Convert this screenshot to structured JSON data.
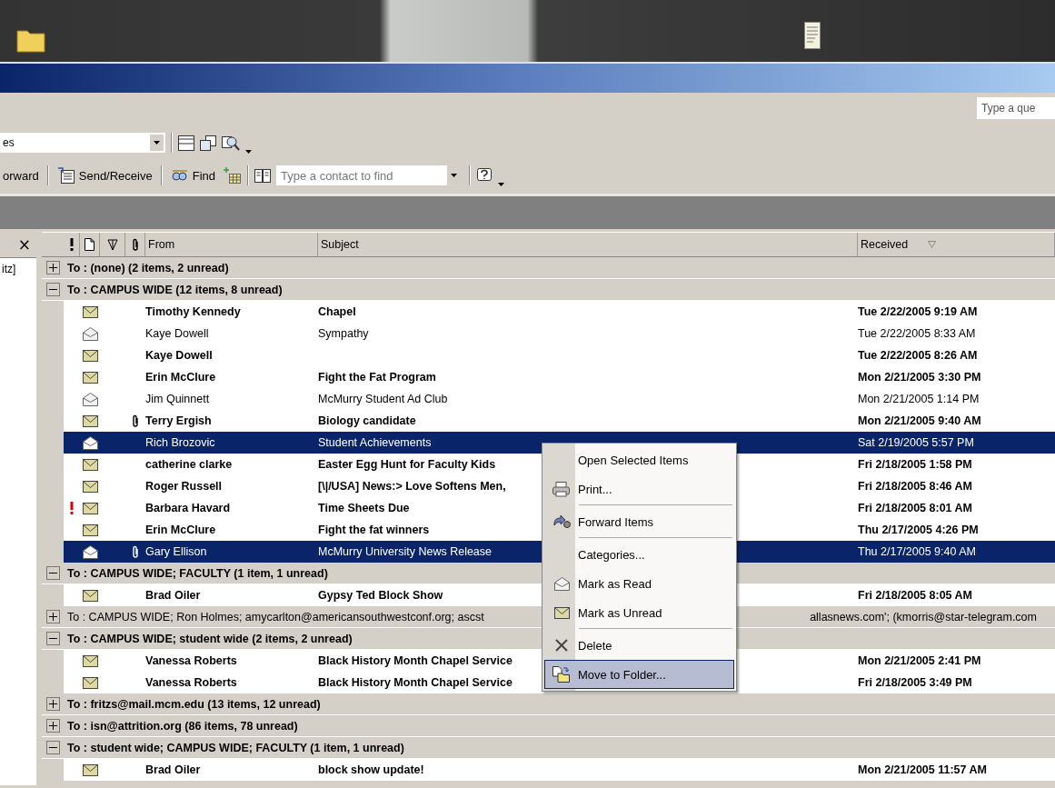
{
  "help_field": {
    "placeholder": "Type a que"
  },
  "toolbar_view": {
    "combo_value": "es"
  },
  "toolbar_standard": {
    "buttons": [
      {
        "kind": "forward",
        "label": "orward"
      },
      {
        "kind": "send-receive",
        "label": "Send/Receive"
      },
      {
        "kind": "find",
        "label": "Find"
      }
    ],
    "contact_search": {
      "placeholder": "Type a contact to find"
    }
  },
  "folder_pane": {
    "close_label": "×",
    "text": "itz]"
  },
  "message_list": {
    "columns": [
      {
        "label": "From",
        "sorted": false
      },
      {
        "label": "Subject",
        "sorted": false
      },
      {
        "label": "Received",
        "sorted": true
      }
    ],
    "groups": [
      {
        "text": "To : (none) (2 items, 2 unread)",
        "expanded": false,
        "has_unread": true
      },
      {
        "text": "To : CAMPUS WIDE (12 items, 8 unread)",
        "expanded": true,
        "has_unread": true,
        "messages": [
          {
            "from": "Timothy Kennedy",
            "subject": "Chapel",
            "received": "Tue 2/22/2005 9:19 AM",
            "read": false,
            "selected": false,
            "high_importance": false,
            "attachment": false
          },
          {
            "from": "Kaye Dowell",
            "subject": "Sympathy",
            "received": "Tue 2/22/2005 8:33 AM",
            "read": true,
            "selected": false,
            "high_importance": false,
            "attachment": false
          },
          {
            "from": "Kaye Dowell",
            "received": "Tue 2/22/2005 8:26 AM",
            "read": false,
            "selected": false,
            "high_importance": false,
            "attachment": false
          },
          {
            "from": "Erin McClure",
            "subject": "Fight the Fat Program",
            "received": "Mon 2/21/2005 3:30 PM",
            "read": false,
            "selected": false,
            "high_importance": false,
            "attachment": false
          },
          {
            "from": "Jim Quinnett",
            "subject": "McMurry Student Ad Club",
            "received": "Mon 2/21/2005 1:14 PM",
            "read": true,
            "selected": false,
            "high_importance": false,
            "attachment": false
          },
          {
            "from": "Terry Ergish",
            "subject": "Biology candidate",
            "received": "Mon 2/21/2005 9:40 AM",
            "read": false,
            "selected": false,
            "high_importance": false,
            "attachment": true
          },
          {
            "from": "Rich Brozovic",
            "subject": "Student Achievements",
            "received": "Sat 2/19/2005 5:57 PM",
            "read": true,
            "selected": true,
            "high_importance": false,
            "attachment": false
          },
          {
            "from": "catherine clarke",
            "subject": "Easter Egg Hunt for Faculty Kids",
            "received": "Fri 2/18/2005 1:58 PM",
            "read": false,
            "selected": false,
            "high_importance": false,
            "attachment": false
          },
          {
            "from": "Roger Russell",
            "subject": "[\\|/USA] News:> Love Softens Men,",
            "received": "Fri 2/18/2005 8:46 AM",
            "read": false,
            "selected": false,
            "high_importance": false,
            "attachment": false
          },
          {
            "from": "Barbara Havard",
            "subject": "Time Sheets Due",
            "received": "Fri 2/18/2005 8:01 AM",
            "read": false,
            "selected": false,
            "high_importance": true,
            "attachment": false
          },
          {
            "from": "Erin McClure",
            "subject": "Fight the fat winners",
            "received": "Thu 2/17/2005 4:26 PM",
            "read": false,
            "selected": false,
            "high_importance": false,
            "attachment": false
          },
          {
            "from": "Gary Ellison",
            "subject": "McMurry University News Release",
            "received": "Thu 2/17/2005 9:40 AM",
            "read": true,
            "selected": true,
            "high_importance": false,
            "attachment": true
          }
        ]
      },
      {
        "text": "To : CAMPUS WIDE; FACULTY (1 item, 1 unread)",
        "expanded": true,
        "has_unread": true,
        "messages": [
          {
            "from": "Brad Oiler",
            "subject": "Gypsy Ted Block Show",
            "received": "Fri 2/18/2005 8:05 AM",
            "read": false,
            "selected": false,
            "high_importance": false,
            "attachment": false
          }
        ]
      },
      {
        "text": "To : CAMPUS WIDE; Ron Holmes; amycarlton@americansouthwestconf.org; ascst",
        "text_continued": "allasnews.com';  (kmorris@star-telegram.com",
        "expanded": false,
        "has_unread": false
      },
      {
        "text": "To : CAMPUS WIDE; student wide (2 items, 2 unread)",
        "expanded": true,
        "has_unread": true,
        "messages": [
          {
            "from": "Vanessa Roberts",
            "subject": "Black History Month Chapel Service",
            "received": "Mon 2/21/2005 2:41 PM",
            "read": false,
            "selected": false,
            "high_importance": false,
            "attachment": false
          },
          {
            "from": "Vanessa Roberts",
            "subject": "Black History Month Chapel Service",
            "received": "Fri 2/18/2005 3:49 PM",
            "read": false,
            "selected": false,
            "high_importance": false,
            "attachment": false
          }
        ]
      },
      {
        "text": "To : fritzs@mail.mcm.edu (13 items, 12 unread)",
        "expanded": false,
        "has_unread": true
      },
      {
        "text": "To : isn@attrition.org (86 items, 78 unread)",
        "expanded": false,
        "has_unread": true
      },
      {
        "text": "To : student wide; CAMPUS WIDE; FACULTY (1 item, 1 unread)",
        "expanded": true,
        "has_unread": true,
        "messages": [
          {
            "from": "Brad Oiler",
            "subject": "block show update!",
            "received": "Mon 2/21/2005 11:57 AM",
            "read": false,
            "selected": false,
            "high_importance": false,
            "attachment": false
          }
        ]
      }
    ]
  },
  "context_menu": {
    "items": [
      {
        "label": "Open Selected Items",
        "kind": "none",
        "separator_before": false,
        "selected": false
      },
      {
        "label": "Print...",
        "kind": "printer",
        "separator_before": false,
        "selected": false
      },
      {
        "label": "Forward Items",
        "kind": "forward",
        "separator_before": true,
        "selected": false
      },
      {
        "label": "Categories...",
        "kind": "none",
        "separator_before": true,
        "selected": false
      },
      {
        "label": "Mark as Read",
        "kind": "open-envelope",
        "separator_before": false,
        "selected": false
      },
      {
        "label": "Mark as Unread",
        "kind": "envelope",
        "separator_before": false,
        "selected": false
      },
      {
        "label": "Delete",
        "kind": "delete",
        "separator_before": true,
        "selected": false
      },
      {
        "label": "Move to Folder...",
        "kind": "move-folder",
        "separator_before": false,
        "selected": true
      }
    ]
  }
}
